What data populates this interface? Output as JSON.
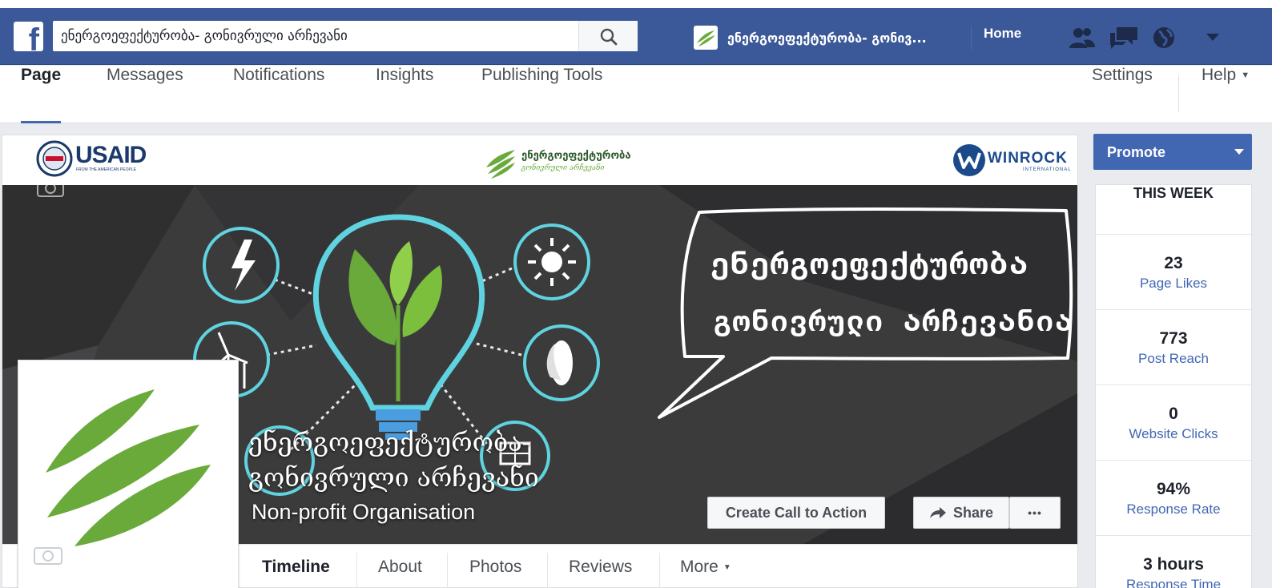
{
  "topbar": {
    "search_value": "ენერგოეფექტურობა- გონივრული არჩევანი",
    "page_shortcut": "ენერგოეფექტურობა- გონივ...",
    "home": "Home"
  },
  "page_nav": {
    "tabs": [
      "Page",
      "Messages",
      "Notifications",
      "Insights",
      "Publishing Tools"
    ],
    "settings": "Settings",
    "help": "Help"
  },
  "cover": {
    "left_logo": "USAID",
    "left_logo_sub": "FROM THE AMERICAN PEOPLE",
    "center_logo": "ენერგოეფექტურობა",
    "center_logo_sub": "გონივრული არჩევანი",
    "right_logo": "WINROCK",
    "right_logo_sub": "INTERNATIONAL",
    "headline_1": "ენერგოეფექტურობა",
    "headline_2": "გონივრული არჩევანია"
  },
  "page": {
    "name_line1": "ენერგოეფექტურობა-",
    "name_line2": "გონივრული არჩევანი",
    "category": "Non-profit Organisation"
  },
  "actions": {
    "cta": "Create Call to Action",
    "share": "Share",
    "more": "•••"
  },
  "timeline_tabs": [
    "Timeline",
    "About",
    "Photos",
    "Reviews",
    "More"
  ],
  "sidebar": {
    "promote": "Promote",
    "header": "THIS WEEK",
    "stats": [
      {
        "value": "23",
        "label": "Page Likes"
      },
      {
        "value": "773",
        "label": "Post Reach"
      },
      {
        "value": "0",
        "label": "Website Clicks"
      },
      {
        "value": "94%",
        "label": "Response Rate"
      },
      {
        "value": "3 hours",
        "label": "Response Time"
      }
    ]
  },
  "colors": {
    "blue_bar": "#3b5998",
    "accent": "#4267b2",
    "leaf_green": "#6aaa3a",
    "bulb_cyan": "#5fd3df"
  }
}
